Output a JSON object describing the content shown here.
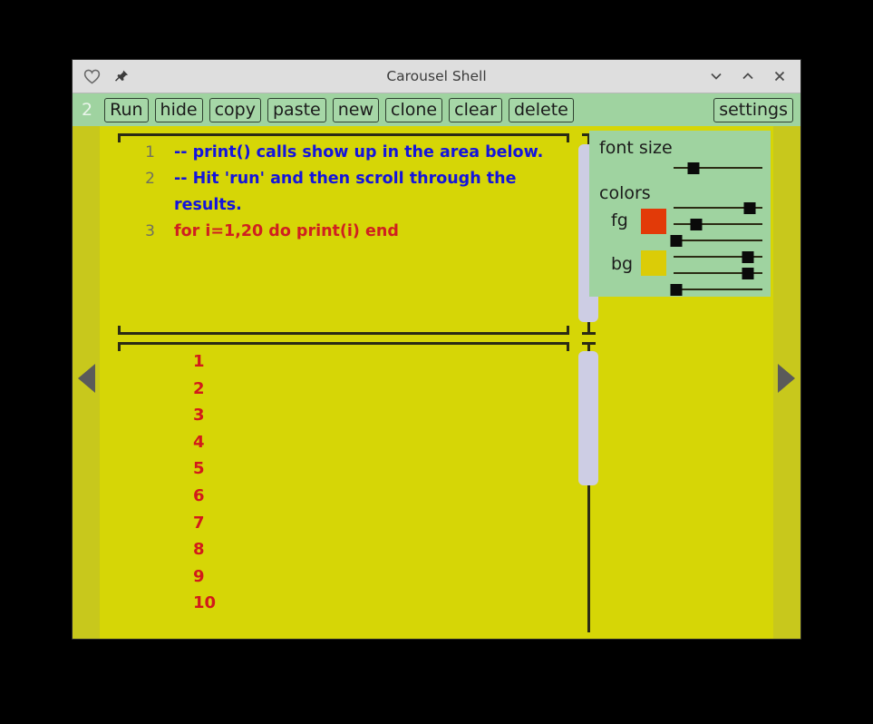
{
  "window": {
    "title": "Carousel Shell",
    "titlebar_icons": [
      "heart-icon",
      "pin-icon"
    ],
    "controls": {
      "minimize": "⌄",
      "maximize": "⌃",
      "close": "✕"
    }
  },
  "toolbar": {
    "index": "2",
    "buttons": [
      "Run",
      "hide",
      "copy",
      "paste",
      "new",
      "clone",
      "clear",
      "delete"
    ],
    "settings_label": "settings"
  },
  "editor": {
    "lines": [
      {
        "num": "1",
        "text": "-- print() calls show up in the area below.",
        "kind": "comment"
      },
      {
        "num": "2",
        "text": "-- Hit 'run' and then scroll through the",
        "kind": "comment"
      },
      {
        "num": "",
        "text": "results.",
        "kind": "comment"
      },
      {
        "num": "3",
        "text": "for i=1,20 do print(i) end",
        "kind": "code"
      }
    ]
  },
  "output": {
    "lines": [
      "1",
      "2",
      "3",
      "4",
      "5",
      "6",
      "7",
      "8",
      "9",
      "10"
    ]
  },
  "settings": {
    "font_size_label": "font size",
    "colors_label": "colors",
    "fg_label": "fg",
    "bg_label": "bg",
    "fg_color": "#e23a08",
    "bg_color": "#dbcc07",
    "sliders": {
      "font_size": 22,
      "fg_r": 86,
      "fg_g": 25,
      "fg_b": 3,
      "bg_r": 84,
      "bg_g": 84,
      "bg_b": 3
    }
  },
  "carousel": {
    "prev": "left-arrow",
    "next": "right-arrow"
  },
  "colors": {
    "page_bg": "#d6d606",
    "edge_strip": "#c8c81c",
    "toolbar_bg": "#9fd3a0",
    "titlebar_bg": "#dedede",
    "comment_color": "#1414dc",
    "code_color": "#cf2020",
    "output_color": "#d21a1a",
    "gutter_color": "#6f7060",
    "scroll_thumb": "#cdcde4"
  }
}
